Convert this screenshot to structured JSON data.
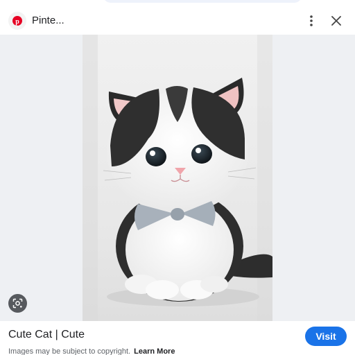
{
  "header": {
    "site_title": "Pinte...",
    "favicon_icon": "pinterest-icon",
    "menu_icon": "more-vert-icon",
    "close_icon": "close-icon"
  },
  "image": {
    "alt": "Fluffy black and white kitten wearing a grey bow tie",
    "lens_icon": "google-lens-icon"
  },
  "result": {
    "title": "Cute Cat | Cute",
    "copyright_text": "Images may be subject to copyright.",
    "learn_more": "Learn More",
    "visit_label": "Visit"
  },
  "colors": {
    "accent": "#1a73e8",
    "pinterest": "#e60023"
  }
}
